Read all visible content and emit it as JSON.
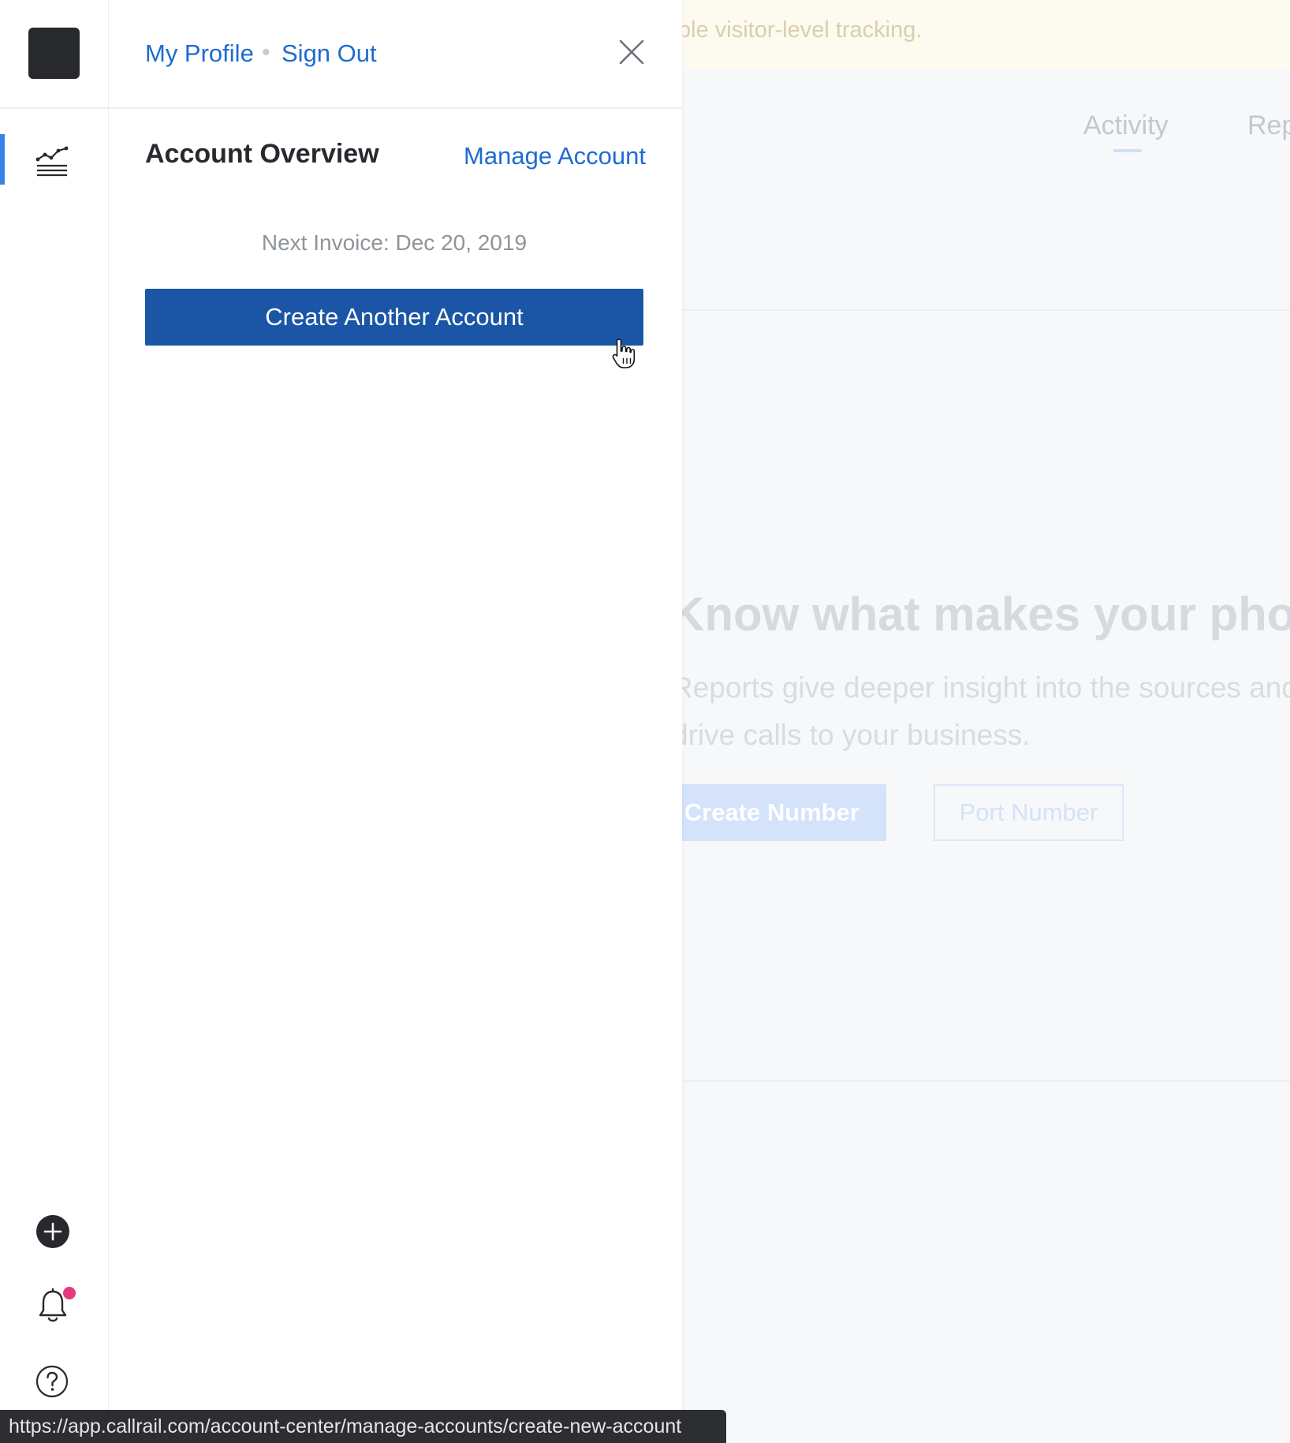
{
  "background": {
    "banner_text": "ble visitor-level tracking.",
    "tabs": [
      {
        "label": "Activity"
      },
      {
        "label": "Rep"
      }
    ],
    "hero": {
      "title": "Know what makes your phon",
      "description": "Reports give deeper insight into the sources and hat drive calls to your business.",
      "primary_button": "Create Number",
      "secondary_button": "Port Number"
    }
  },
  "rail": {
    "icons": [
      "logo",
      "analytics-icon",
      "plus-icon",
      "bell-icon",
      "help-icon"
    ],
    "notification_dot_color": "#e6397f",
    "active_color": "#3b82e8"
  },
  "panel": {
    "my_profile": "My Profile",
    "separator": "•",
    "sign_out": "Sign Out",
    "title": "Account Overview",
    "manage_account": "Manage Account",
    "next_invoice": "Next Invoice: Dec 20, 2019",
    "create_button": "Create Another Account",
    "link_color": "#1e6bd1",
    "button_color": "#1a56a5"
  },
  "status_bar": {
    "url": "https://app.callrail.com/account-center/manage-accounts/create-new-account"
  }
}
